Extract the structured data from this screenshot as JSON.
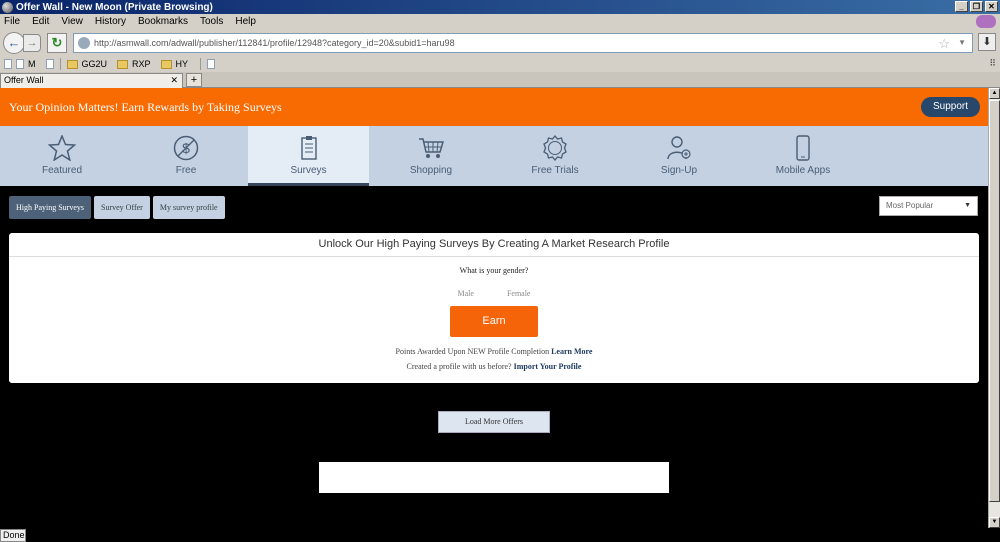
{
  "window": {
    "title": "Offer Wall - New Moon (Private Browsing)"
  },
  "menu": [
    "File",
    "Edit",
    "View",
    "History",
    "Bookmarks",
    "Tools",
    "Help"
  ],
  "nav": {
    "url": "http://asmwall.com/adwall/publisher/112841/profile/12948?category_id=20&subid1=haru98"
  },
  "bookmarks": [
    "M",
    "GG2U",
    "RXP",
    "HY"
  ],
  "tabs": [
    {
      "label": "Offer Wall"
    }
  ],
  "page": {
    "banner_text": "Your Opinion Matters! Earn Rewards by Taking Surveys",
    "support_label": "Support",
    "categories": [
      {
        "label": "Featured",
        "icon": "star-icon"
      },
      {
        "label": "Free",
        "icon": "dollar-icon"
      },
      {
        "label": "Surveys",
        "icon": "clipboard-icon",
        "active": true
      },
      {
        "label": "Shopping",
        "icon": "cart-icon"
      },
      {
        "label": "Free Trials",
        "icon": "badge-icon"
      },
      {
        "label": "Sign-Up",
        "icon": "user-add-icon"
      },
      {
        "label": "Mobile Apps",
        "icon": "phone-icon"
      }
    ],
    "subtabs": [
      "High Paying Surveys",
      "Survey Offer",
      "My survey profile"
    ],
    "sort_value": "Most Popular",
    "card": {
      "title": "Unlock Our High Paying Surveys By Creating A Market Research Profile",
      "question": "What is your gender?",
      "options": [
        "Male",
        "Female"
      ],
      "earn_label": "Earn",
      "note1_text": "Points Awarded Upon NEW Profile Completion",
      "note1_link": "Learn More",
      "note2_text": "Created a profile with us before?",
      "note2_link": "Import Your Profile"
    },
    "load_more_label": "Load More Offers"
  },
  "status": "Done",
  "colors": {
    "accent": "#f86b02",
    "support_bg": "#27476b",
    "category_bg": "#c3d1e2"
  }
}
